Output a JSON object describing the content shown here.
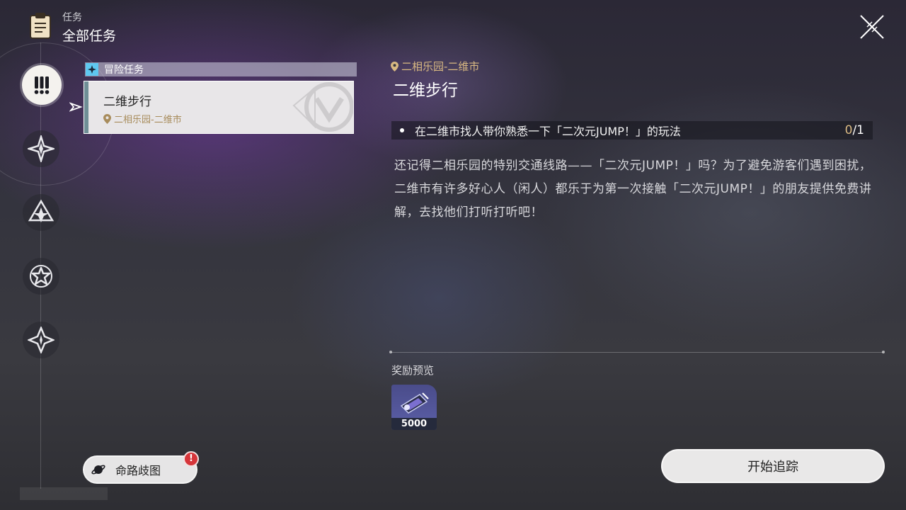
{
  "header": {
    "category": "任务",
    "title": "全部任务",
    "icon": "clipboard-icon"
  },
  "rail": {
    "tabs": [
      {
        "icon": "exclamation-icon",
        "active": true
      },
      {
        "icon": "diamond-star-icon",
        "active": false
      },
      {
        "icon": "triangle-star-icon",
        "active": false
      },
      {
        "icon": "star-circle-icon",
        "active": false
      },
      {
        "icon": "compass-star-icon",
        "active": false
      }
    ]
  },
  "quest_list": {
    "category_label": "冒险任务",
    "quests": [
      {
        "name": "二维步行",
        "location": "二相乐园-二维市",
        "selected": true
      }
    ]
  },
  "detail": {
    "location": "二相乐园-二维市",
    "title": "二维步行",
    "objective": {
      "text": "在二维市找人带你熟悉一下「二次元JUMP！」的玩法",
      "current": "0",
      "total": "/1"
    },
    "description": "还记得二相乐园的特别交通线路——「二次元JUMP！」吗？为了避免游客们遇到困扰，二维市有许多好心人（闲人）都乐于为第一次接触「二次元JUMP！」的朋友提供免费讲解，去找他们打听打听吧！",
    "reward_title": "奖励预览",
    "rewards": [
      {
        "icon": "credit-ticket-icon",
        "quantity": "5000"
      }
    ]
  },
  "buttons": {
    "path_map": "命路歧图",
    "path_map_badge": "!",
    "track": "开始追踪"
  },
  "colors": {
    "accent_gold": "#d9b982",
    "category_badge": "#5fc8f0",
    "alert_red": "#d6353a"
  }
}
